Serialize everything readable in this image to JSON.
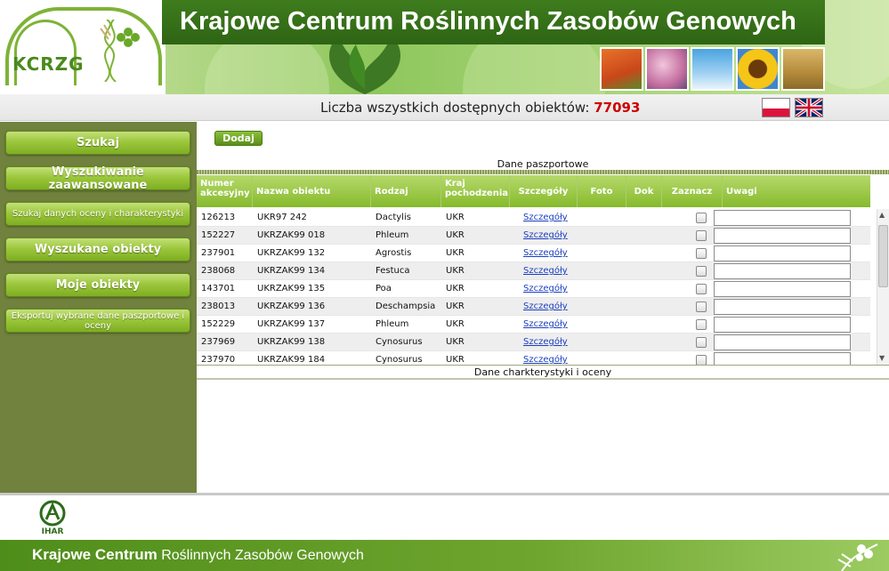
{
  "header": {
    "logo_text": "KCRZG",
    "site_title": "Krajowe Centrum Roślinnych Zasobów Genowych",
    "thumbnails": [
      "carrots-thumb",
      "magnolia-thumb",
      "flower-sky-thumb",
      "sunflower-thumb",
      "wheat-thumb"
    ]
  },
  "count_bar": {
    "label": "Liczba wszystkich dostępnych obiektów:",
    "value": "77093"
  },
  "sidebar": {
    "items": [
      {
        "label": "Szukaj"
      },
      {
        "label": "Wyszukiwanie zaawansowane"
      },
      {
        "label": "Szukaj danych oceny i charakterystyki"
      },
      {
        "label": "Wyszukane obiekty"
      },
      {
        "label": "Moje obiekty"
      },
      {
        "label": "Eksportuj wybrane dane paszportowe i oceny"
      }
    ]
  },
  "main": {
    "add_button": "Dodaj",
    "section_passport": "Dane paszportowe",
    "section_characteristics": "Dane charkterystyki i oceny",
    "columns": [
      "Numer akcesyjny",
      "Nazwa obiektu",
      "Rodzaj",
      "Kraj pochodzenia",
      "Szczegóły",
      "Foto",
      "Dok",
      "Zaznacz",
      "Uwagi"
    ],
    "rows": [
      {
        "id": "126213",
        "name": "UKR97 242",
        "genus": "Dactylis",
        "country": "UKR",
        "details": "Szczegóły"
      },
      {
        "id": "152227",
        "name": "UKRZAK99 018",
        "genus": "Phleum",
        "country": "UKR",
        "details": "Szczegóły"
      },
      {
        "id": "237901",
        "name": "UKRZAK99 132",
        "genus": "Agrostis",
        "country": "UKR",
        "details": "Szczegóły"
      },
      {
        "id": "238068",
        "name": "UKRZAK99 134",
        "genus": "Festuca",
        "country": "UKR",
        "details": "Szczegóły"
      },
      {
        "id": "143701",
        "name": "UKRZAK99 135",
        "genus": "Poa",
        "country": "UKR",
        "details": "Szczegóły"
      },
      {
        "id": "238013",
        "name": "UKRZAK99 136",
        "genus": "Deschampsia",
        "country": "UKR",
        "details": "Szczegóły"
      },
      {
        "id": "152229",
        "name": "UKRZAK99 137",
        "genus": "Phleum",
        "country": "UKR",
        "details": "Szczegóły"
      },
      {
        "id": "237969",
        "name": "UKRZAK99 138",
        "genus": "Cynosurus",
        "country": "UKR",
        "details": "Szczegóły"
      },
      {
        "id": "237970",
        "name": "UKRZAK99 184",
        "genus": "Cynosurus",
        "country": "UKR",
        "details": "Szczegóły"
      }
    ]
  },
  "footer": {
    "logo_text": "IHAR",
    "title_bold": "Krajowe Centrum",
    "title_rest": "Roślinnych Zasobów Genowych"
  },
  "colors": {
    "accent_green": "#86ba2c",
    "sidebar_bg": "#71813e",
    "title_band": "#2e6414",
    "count_red": "#cc0000"
  }
}
